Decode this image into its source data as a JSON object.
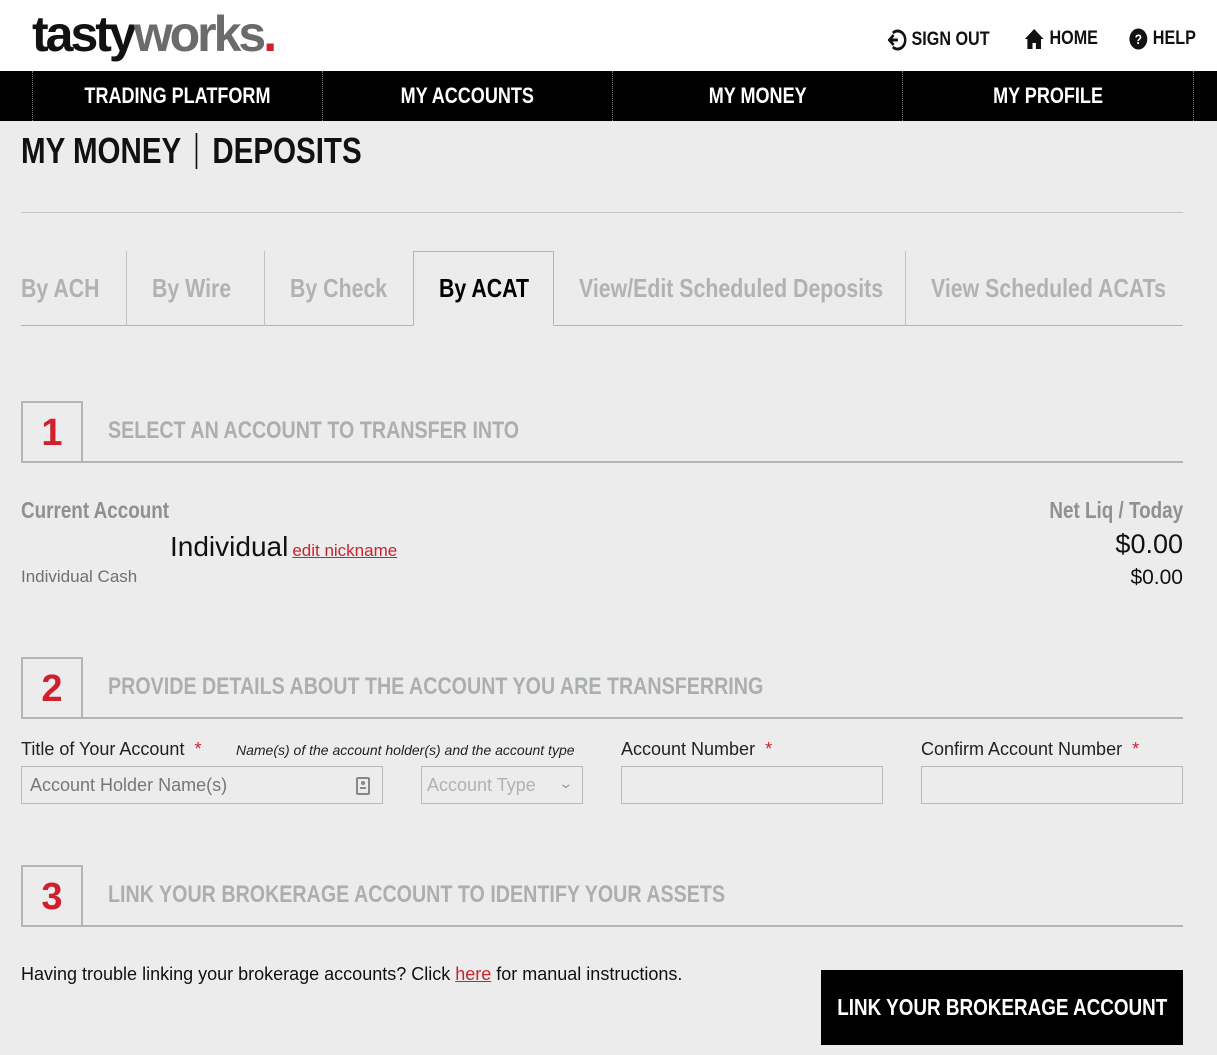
{
  "brand": {
    "part1": "tasty",
    "part2": "works",
    "dot": ".",
    "accent": "#d0202e"
  },
  "utility_nav": [
    {
      "label": "SIGN OUT",
      "icon": "sign-out-icon"
    },
    {
      "label": "HOME",
      "icon": "home-icon"
    },
    {
      "label": "HELP",
      "icon": "help-icon"
    }
  ],
  "main_nav": [
    {
      "label": "TRADING PLATFORM"
    },
    {
      "label": "MY ACCOUNTS"
    },
    {
      "label": "MY MONEY"
    },
    {
      "label": "MY PROFILE"
    }
  ],
  "page": {
    "section": "MY MONEY",
    "subsection": "DEPOSITS"
  },
  "tabs": [
    {
      "label": "By ACH",
      "active": false
    },
    {
      "label": "By Wire",
      "active": false
    },
    {
      "label": "By Check",
      "active": false
    },
    {
      "label": "By ACAT",
      "active": true
    },
    {
      "label": "View/Edit Scheduled Deposits",
      "active": false
    },
    {
      "label": "View Scheduled ACATs",
      "active": false
    }
  ],
  "steps": [
    {
      "number": "1",
      "title": "SELECT AN ACCOUNT TO TRANSFER INTO"
    },
    {
      "number": "2",
      "title": "PROVIDE DETAILS ABOUT THE ACCOUNT YOU ARE TRANSFERRING"
    },
    {
      "number": "3",
      "title": "LINK YOUR BROKERAGE ACCOUNT TO IDENTIFY YOUR ASSETS"
    }
  ],
  "account": {
    "current_label": "Current Account",
    "nickname": "Individual",
    "edit_link": "edit nickname",
    "type": "Individual Cash",
    "netliq_label": "Net Liq / Today",
    "net_liq": "$0.00",
    "today": "$0.00"
  },
  "form": {
    "title_label": "Title of Your Account",
    "title_hint": "Name(s) of the account holder(s) and the account type",
    "title_placeholder": "Account Holder Name(s)",
    "account_type_placeholder": "Account Type",
    "account_number_label": "Account Number",
    "confirm_label": "Confirm Account Number",
    "required_mark": "*"
  },
  "link_section": {
    "text_before": "Having trouble linking your brokerage accounts? Click ",
    "link": "here",
    "text_after": " for manual instructions.",
    "button": "LINK YOUR BROKERAGE ACCOUNT"
  }
}
